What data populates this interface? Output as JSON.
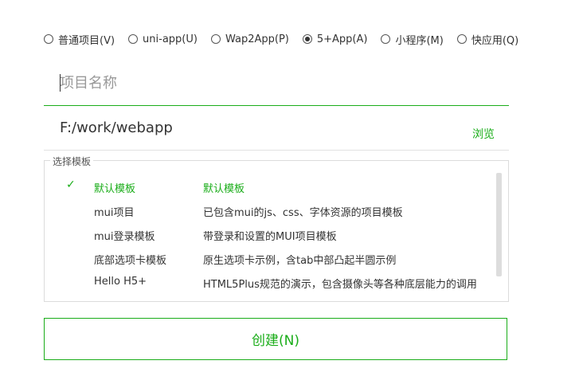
{
  "project_types": [
    {
      "label": "普通项目(V)",
      "checked": false
    },
    {
      "label": "uni-app(U)",
      "checked": false
    },
    {
      "label": "Wap2App(P)",
      "checked": false
    },
    {
      "label": "5+App(A)",
      "checked": true
    },
    {
      "label": "小程序(M)",
      "checked": false
    },
    {
      "label": "快应用(Q)",
      "checked": false
    }
  ],
  "name_field": {
    "value": "",
    "placeholder": "项目名称"
  },
  "path_field": {
    "value": "F:/work/webapp",
    "browse_label": "浏览"
  },
  "template_section": {
    "legend": "选择模板",
    "check_glyph": "✓",
    "templates": [
      {
        "name": "默认模板",
        "desc": "默认模板",
        "selected": true
      },
      {
        "name": "mui项目",
        "desc": "已包含mui的js、css、字体资源的项目模板",
        "selected": false
      },
      {
        "name": "mui登录模板",
        "desc": "带登录和设置的MUI项目模板",
        "selected": false
      },
      {
        "name": "底部选项卡模板",
        "desc": "原生选项卡示例，含tab中部凸起半圆示例",
        "selected": false
      },
      {
        "name": "Hello H5+",
        "desc": "HTML5Plus规范的演示，包含摄像头等各种底层能力的调用",
        "selected": false
      }
    ]
  },
  "create_button": {
    "label": "创建(N)"
  },
  "colors": {
    "accent": "#1aad19",
    "text": "#333333",
    "placeholder": "#999999",
    "border": "#dcdcdc"
  }
}
